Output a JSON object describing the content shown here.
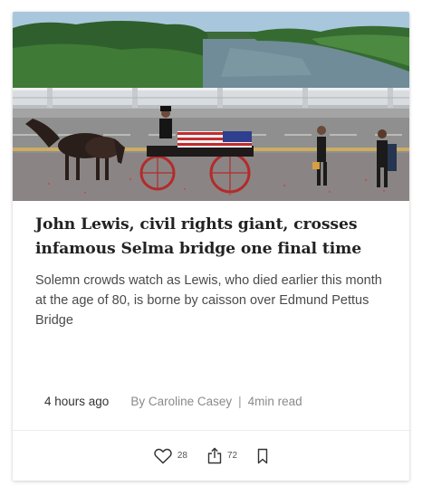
{
  "article": {
    "headline_line1": "John Lewis, civil rights giant, crosses",
    "headline_line2": "infamous Selma bridge one final time",
    "dek": "Solemn crowds watch as Lewis, who died earlier this month at the age of 80, is borne by caisson over Edmund Pettus Bridge",
    "time": "4 hours ago",
    "byline": "By Caroline Casey",
    "separator": "|",
    "read_time": "4min read"
  },
  "actions": {
    "like_count": "28",
    "share_count": "72"
  },
  "icons": {
    "like": "heart-icon",
    "share": "share-icon",
    "bookmark": "bookmark-icon"
  },
  "colors": {
    "headline": "#222222",
    "body": "#4a4a4a",
    "meta": "#8a8a8a"
  }
}
